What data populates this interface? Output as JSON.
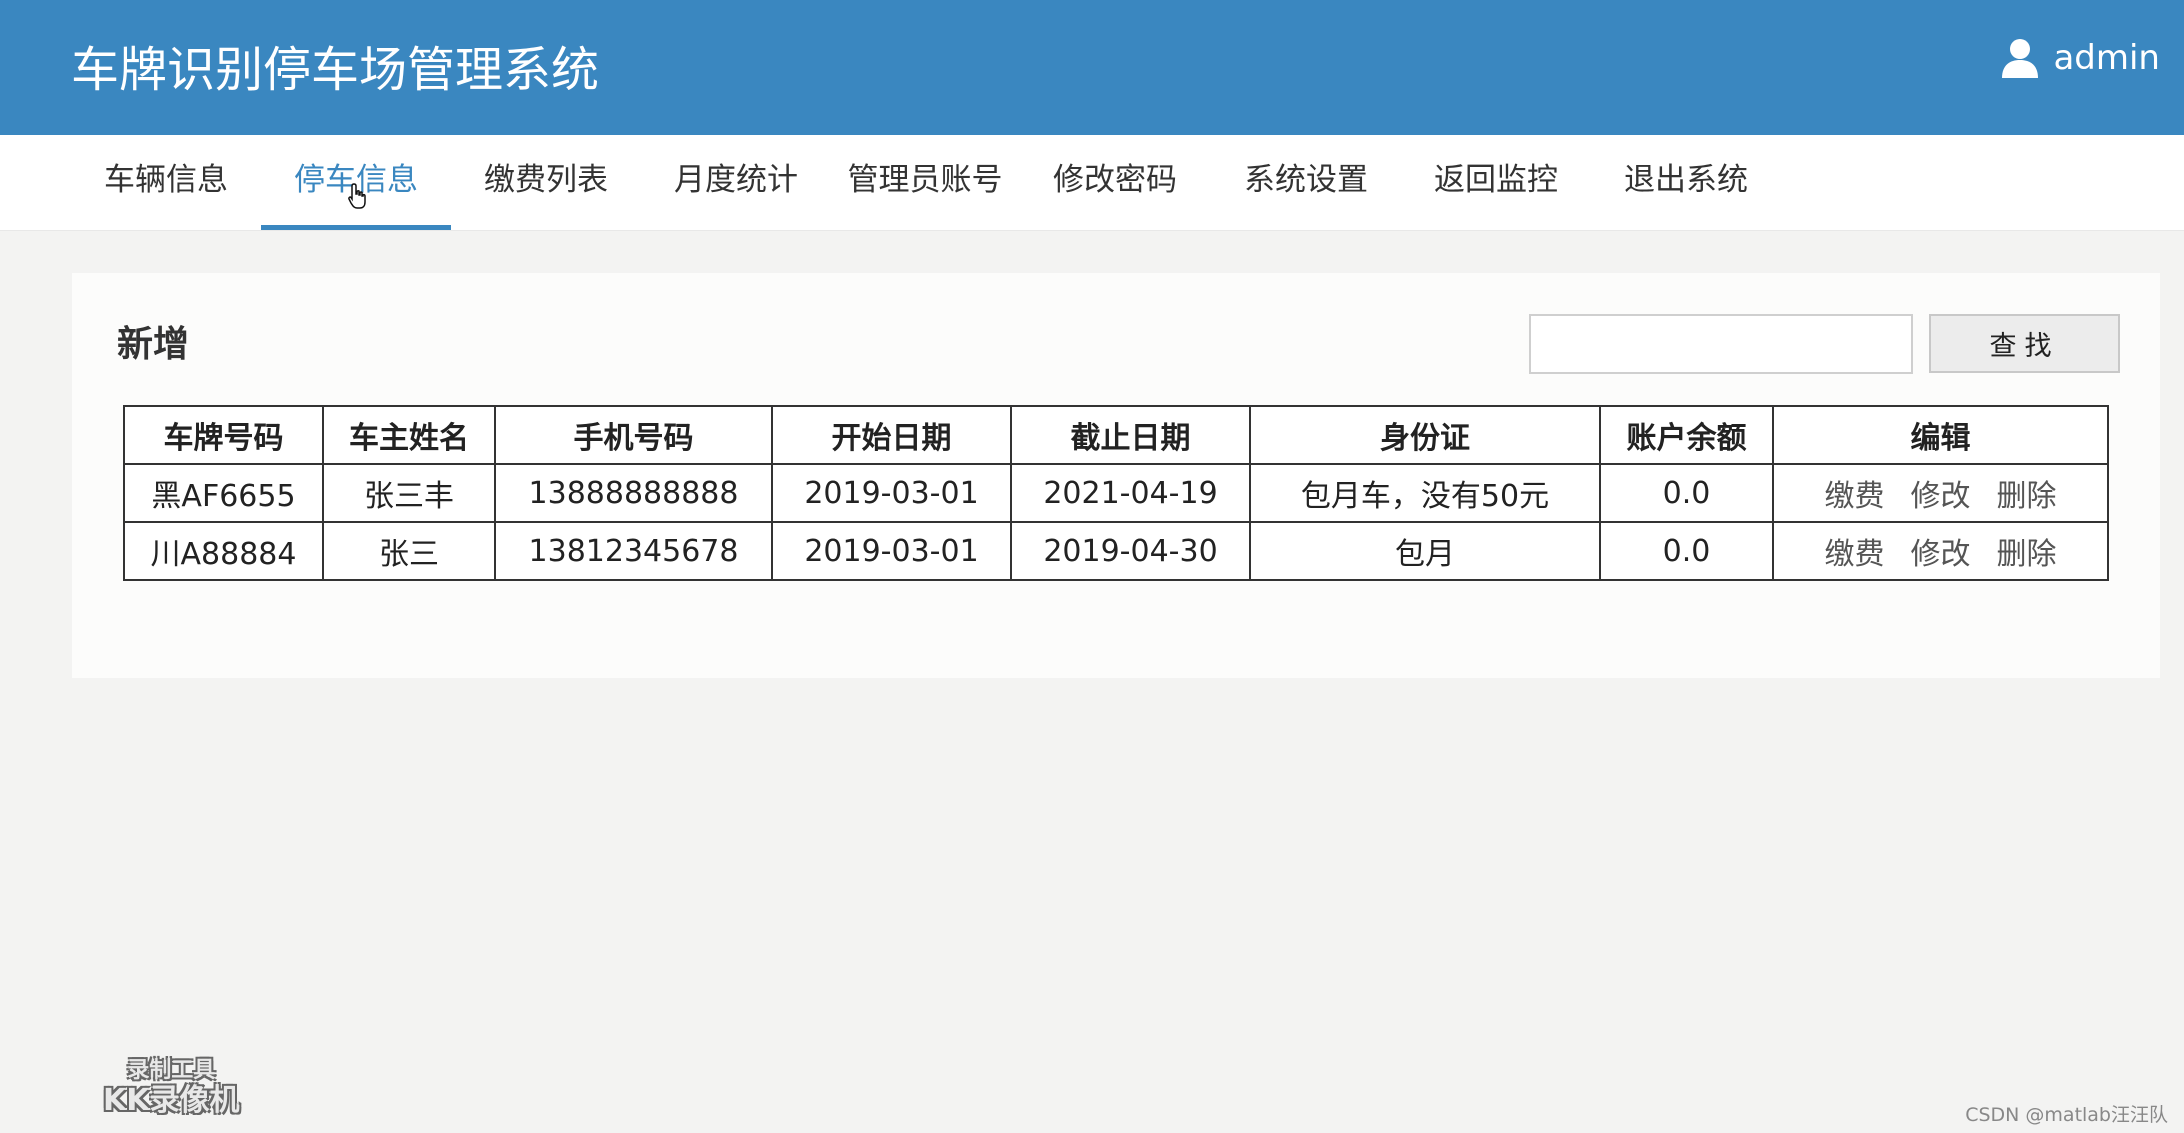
{
  "header": {
    "title": "车牌识别停车场管理系统",
    "user_icon": "user-icon",
    "user_name": "admin",
    "background_color": "#3a87c0"
  },
  "nav": {
    "active_index": 1,
    "items": [
      {
        "label": "车辆信息"
      },
      {
        "label": "停车信息"
      },
      {
        "label": "缴费列表"
      },
      {
        "label": "月度统计"
      },
      {
        "label": "管理员账号"
      },
      {
        "label": "修改密码"
      },
      {
        "label": "系统设置"
      },
      {
        "label": "返回监控"
      },
      {
        "label": "退出系统"
      }
    ]
  },
  "toolbar": {
    "add_label": "新增",
    "search_value": "",
    "search_button_label": "查找"
  },
  "table": {
    "headers": [
      "车牌号码",
      "车主姓名",
      "手机号码",
      "开始日期",
      "截止日期",
      "身份证",
      "账户余额",
      "编辑"
    ],
    "rows": [
      {
        "plate": "黑AF6655",
        "owner": "张三丰",
        "phone": "13888888888",
        "start_date": "2019-03-01",
        "end_date": "2021-04-19",
        "id_card": "包月车，没有50元",
        "balance": "0.0",
        "actions": [
          "缴费",
          "修改",
          "删除"
        ]
      },
      {
        "plate": "川A88884",
        "owner": "张三",
        "phone": "13812345678",
        "start_date": "2019-03-01",
        "end_date": "2019-04-30",
        "id_card": "包月",
        "balance": "0.0",
        "actions": [
          "缴费",
          "修改",
          "删除"
        ]
      }
    ]
  },
  "overlay": {
    "recorder_line1": "录制工具",
    "recorder_line2": "KK录像机",
    "watermark": "CSDN @matlab汪汪队"
  }
}
